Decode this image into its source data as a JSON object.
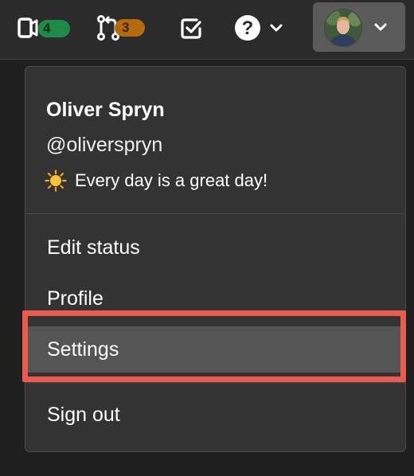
{
  "topbar": {
    "merge_requests_count": "4",
    "merge_requests_icon": "merge-request-icon",
    "pull_requests_count": "3",
    "pull_requests_icon": "git-merge-icon",
    "todos_icon": "checkbox-icon",
    "help_icon": "help-icon",
    "help_chevron_icon": "chevron-down-icon",
    "user_chevron_icon": "chevron-down-icon",
    "accent_green": "#1e8b48",
    "accent_orange": "#b46b10"
  },
  "dropdown": {
    "user_name": "Oliver Spryn",
    "user_handle": "@oliverspryn",
    "status_emoji": "sun-icon",
    "status_text": "Every day is a great day!",
    "menu": {
      "edit_status": "Edit status",
      "profile": "Profile",
      "settings": "Settings",
      "sign_out": "Sign out"
    },
    "highlight_color": "#ec5a4e"
  }
}
